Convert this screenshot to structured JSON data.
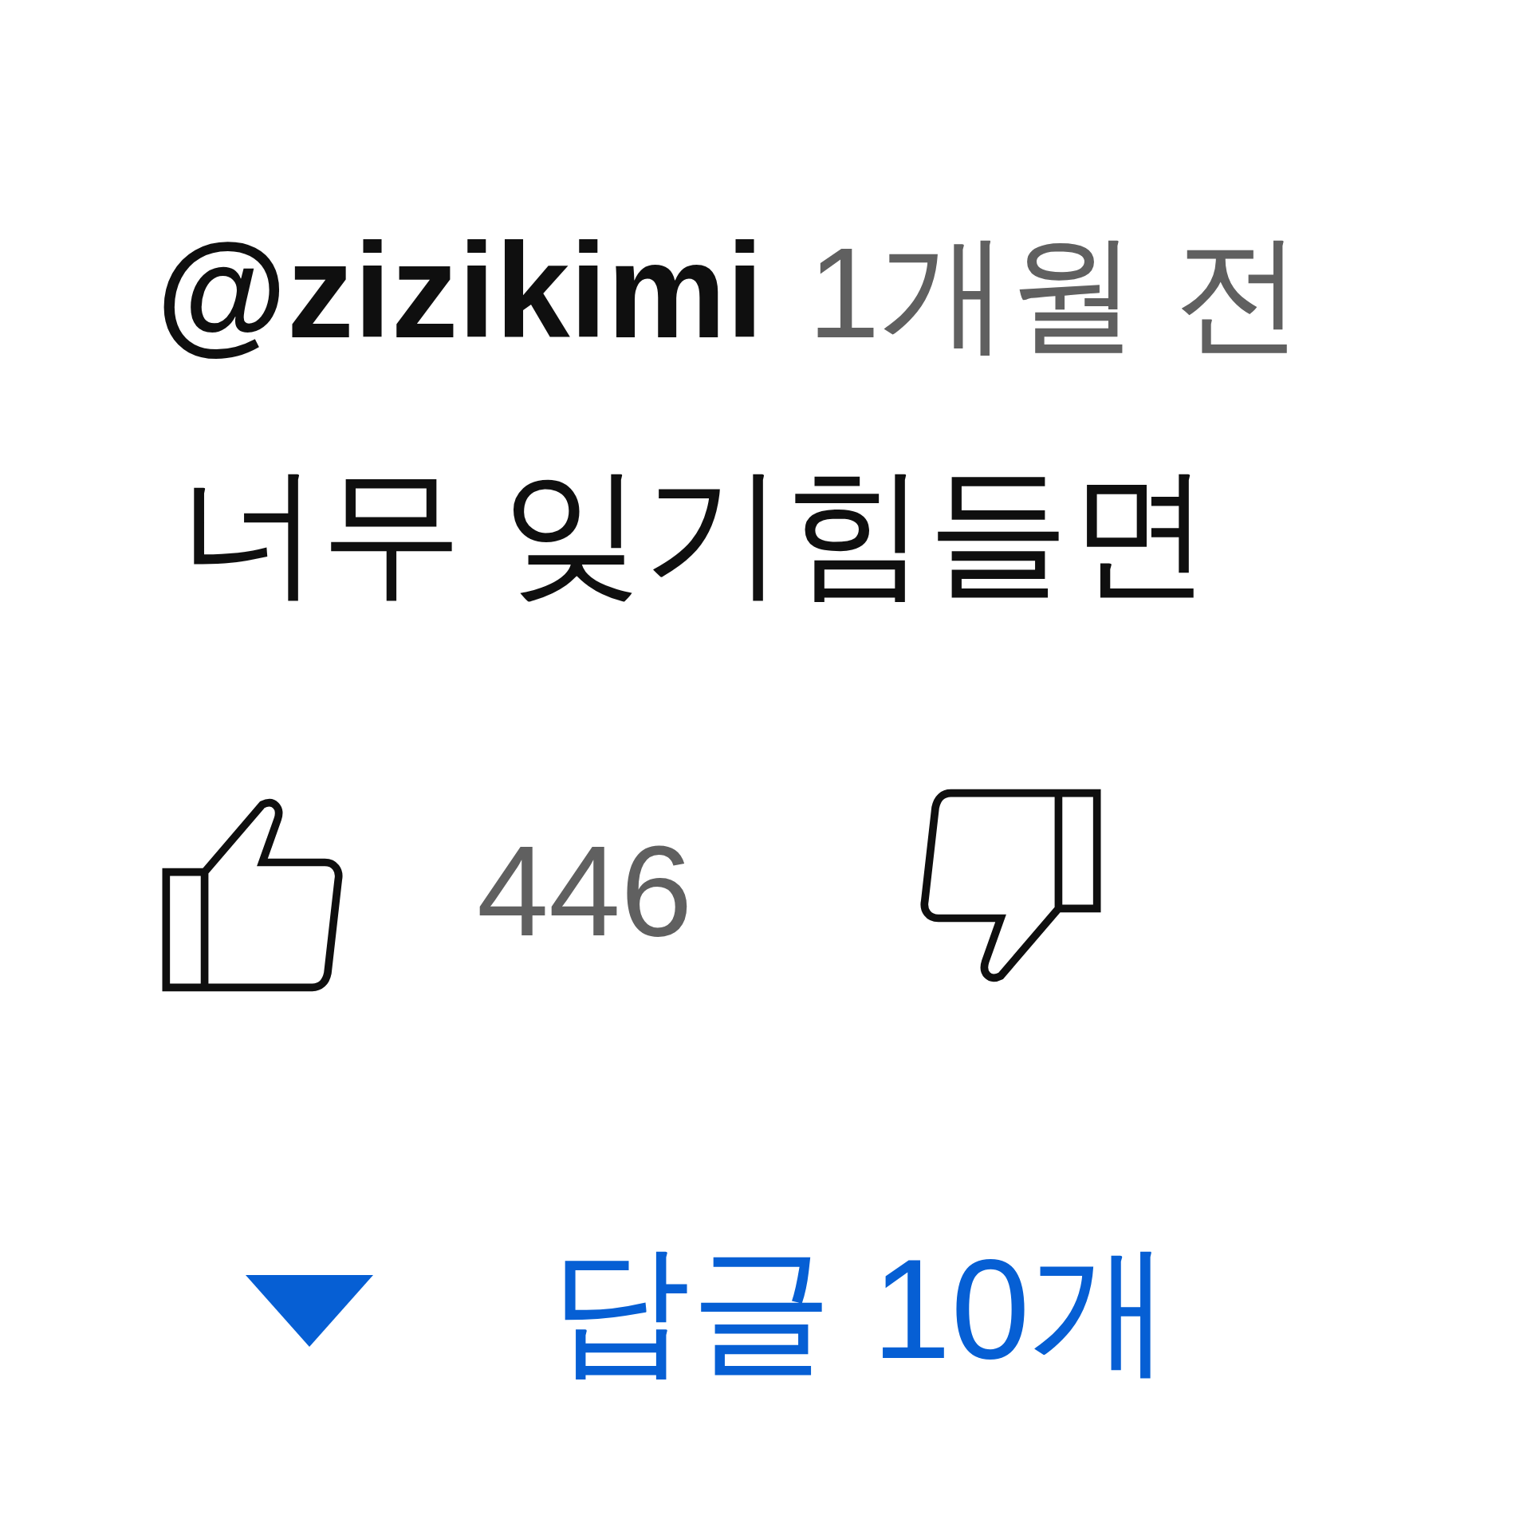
{
  "comment": {
    "author": "@zizikimi",
    "time": "1개월 전",
    "text": "너무 잊기힘들면",
    "likes": "446",
    "replies": {
      "label": "답글 10개",
      "expanded": false
    }
  }
}
